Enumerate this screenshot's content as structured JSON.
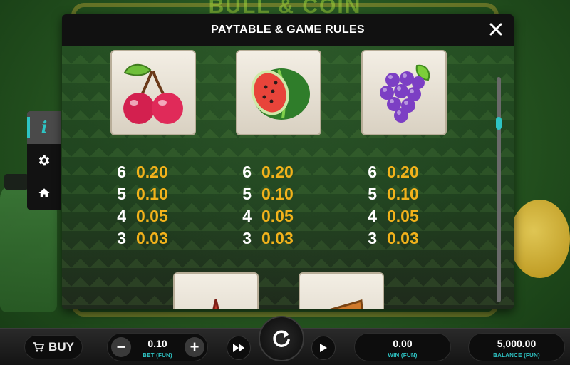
{
  "modal": {
    "title": "PAYTABLE & GAME RULES"
  },
  "symbols": [
    {
      "name": "cherry",
      "icon": "cherry-icon",
      "payouts": [
        {
          "count": "6",
          "value": "0.20"
        },
        {
          "count": "5",
          "value": "0.10"
        },
        {
          "count": "4",
          "value": "0.05"
        },
        {
          "count": "3",
          "value": "0.03"
        }
      ]
    },
    {
      "name": "watermelon",
      "icon": "watermelon-icon",
      "payouts": [
        {
          "count": "6",
          "value": "0.20"
        },
        {
          "count": "5",
          "value": "0.10"
        },
        {
          "count": "4",
          "value": "0.05"
        },
        {
          "count": "3",
          "value": "0.03"
        }
      ]
    },
    {
      "name": "grapes",
      "icon": "grapes-icon",
      "payouts": [
        {
          "count": "6",
          "value": "0.20"
        },
        {
          "count": "5",
          "value": "0.10"
        },
        {
          "count": "4",
          "value": "0.05"
        },
        {
          "count": "3",
          "value": "0.03"
        }
      ]
    }
  ],
  "next_symbols": [
    "letter-a-icon",
    "letter-k-icon"
  ],
  "side_menu": [
    {
      "icon": "info-icon",
      "active": true
    },
    {
      "icon": "gear-icon",
      "active": false
    },
    {
      "icon": "home-icon",
      "active": false
    }
  ],
  "bottom_bar": {
    "buy_label": "BUY",
    "bet_value": "0.10",
    "bet_label": "BET (FUN)",
    "win_value": "0.00",
    "win_label": "WIN (FUN)",
    "balance_value": "5,000.00",
    "balance_label": "BALANCE (FUN)"
  },
  "colors": {
    "accent": "#2ec4c4",
    "payout": "#f2b21b",
    "modal_bg": "#1c1c1c"
  }
}
